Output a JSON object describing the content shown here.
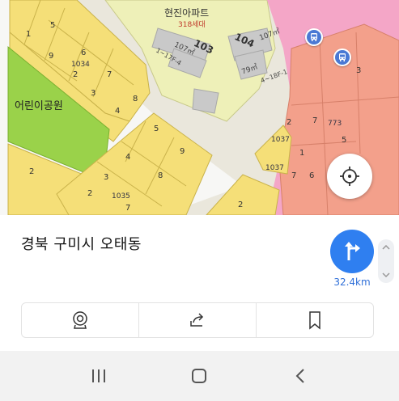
{
  "map": {
    "labels": {
      "apartment_name": "현진아파트",
      "apartment_units": "318세대",
      "building_103": "103",
      "building_104": "104",
      "area_107a": "107㎡",
      "area_107b": "107㎡",
      "area_79": "79㎡",
      "floors_a": "1~17F-4",
      "floors_b": "4~18F-1",
      "park": "어린이공원",
      "lot_1034": "1034",
      "lot_1035": "1035",
      "lot_1037a": "1037",
      "lot_1037b": "1037",
      "lot_773": "773",
      "n1": "1",
      "n2": "2",
      "n3": "3",
      "n4": "4",
      "n5": "5",
      "n6": "6",
      "n7": "7",
      "n8": "8",
      "n9": "9",
      "m2": "2",
      "m3": "3",
      "m4": "4",
      "m5": "5",
      "m7": "7",
      "m8": "8",
      "m9": "9",
      "k2": "2",
      "k3": "3",
      "k7": "7",
      "k1": "1",
      "k6": "6",
      "k5": "5",
      "j2": "2",
      "j3": "3",
      "j6": "6",
      "tiny2": "2"
    },
    "icons": {
      "bus_stop": "bus-icon",
      "locate": "crosshair-icon"
    }
  },
  "place": {
    "address": "경북 구미시 오태동",
    "distance": "32.4km"
  },
  "actions": [
    {
      "name": "streetview",
      "icon": "map-pin-camera-icon"
    },
    {
      "name": "share",
      "icon": "share-icon"
    },
    {
      "name": "bookmark",
      "icon": "bookmark-icon"
    }
  ],
  "colors": {
    "route_button": "#2f7ff0",
    "distance_text": "#2f6fd8",
    "park": "#9ad24a",
    "residential": "#f6e27d",
    "commercial": "#f4a6c7",
    "salmon_lot": "#f3a08b"
  }
}
